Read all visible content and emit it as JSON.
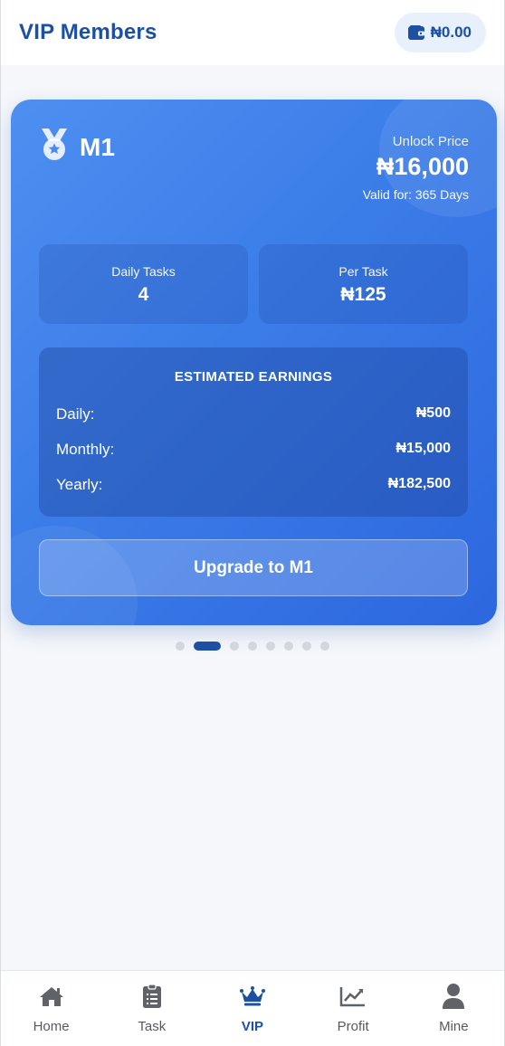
{
  "header": {
    "title": "VIP Members",
    "balance": "₦0.00",
    "wallet_icon": "wallet-icon"
  },
  "vip_card": {
    "level_icon": "medal-icon",
    "level": "M1",
    "price_label": "Unlock Price",
    "price": "₦16,000",
    "validity": "Valid for: 365 Days",
    "daily_tasks_label": "Daily Tasks",
    "daily_tasks_value": "4",
    "per_task_label": "Per Task",
    "per_task_value": "₦125",
    "earnings_title": "ESTIMATED EARNINGS",
    "earnings": [
      {
        "label": "Daily:",
        "value": "₦500"
      },
      {
        "label": "Monthly:",
        "value": "₦15,000"
      },
      {
        "label": "Yearly:",
        "value": "₦182,500"
      }
    ],
    "upgrade_label": "Upgrade to M1"
  },
  "pager": {
    "count": 8,
    "active_index": 1
  },
  "nav": {
    "items": [
      {
        "label": "Home",
        "icon": "home-icon"
      },
      {
        "label": "Task",
        "icon": "clipboard-icon"
      },
      {
        "label": "VIP",
        "icon": "crown-icon",
        "active": true
      },
      {
        "label": "Profit",
        "icon": "chart-icon"
      },
      {
        "label": "Mine",
        "icon": "user-icon"
      }
    ]
  },
  "colors": {
    "brand": "#1d4fa3",
    "card_start": "#4e8ff1",
    "card_end": "#2d67df",
    "inactive_nav": "#555a62"
  }
}
